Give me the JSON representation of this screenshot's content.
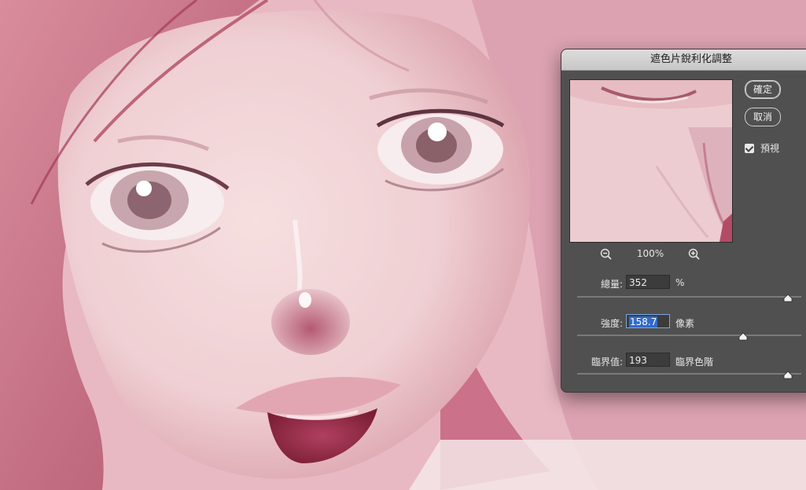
{
  "dialog": {
    "title": "遮色片銳利化調整",
    "ok_label": "確定",
    "cancel_label": "取消",
    "preview_label": "預視",
    "preview_checked": true,
    "zoom_level": "100%"
  },
  "params": [
    {
      "label": "總量:",
      "value": "352",
      "unit": "%",
      "slider_fraction": 0.94
    },
    {
      "label": "強度:",
      "value": "158.7",
      "unit": "像素",
      "slider_fraction": 0.74
    },
    {
      "label": "臨界值:",
      "value": "193",
      "unit": "臨界色階",
      "slider_fraction": 0.94
    }
  ],
  "colors": {
    "dialog_bg": "#505050",
    "selection": "#2f6bd0"
  }
}
